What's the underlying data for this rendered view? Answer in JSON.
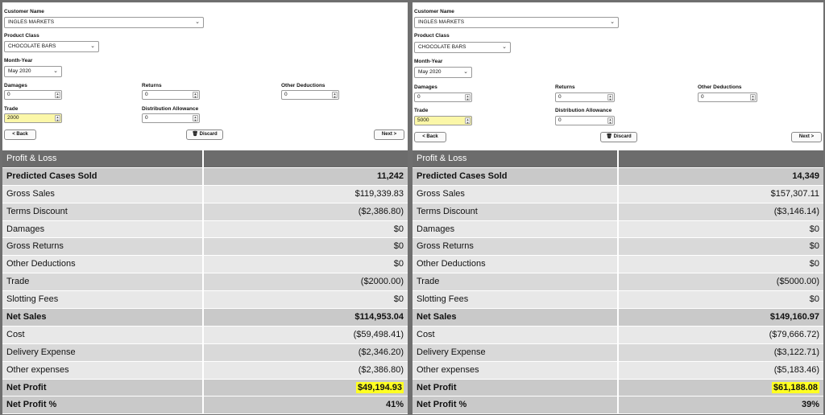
{
  "panels": [
    {
      "form": {
        "customer_label": "Customer Name",
        "customer_value": "INGLES MARKETS",
        "class_label": "Product Class",
        "class_value": "CHOCOLATE BARS",
        "month_label": "Month-Year",
        "month_value": "May 2020",
        "damages_label": "Damages",
        "damages_value": "0",
        "returns_label": "Returns",
        "returns_value": "0",
        "other_label": "Other Deductions",
        "other_value": "0",
        "trade_label": "Trade",
        "trade_value": "2000",
        "dist_label": "Distribution Allowance",
        "dist_value": "0",
        "back_label": "< Back",
        "discard_label": "Discard",
        "next_label": "Next >"
      },
      "pl": {
        "header": "Profit & Loss",
        "rows": [
          {
            "label": "Predicted Cases Sold",
            "value": "11,242"
          },
          {
            "label": "Gross Sales",
            "value": "$119,339.83"
          },
          {
            "label": "Terms Discount",
            "value": "($2,386.80)"
          },
          {
            "label": "Damages",
            "value": "$0"
          },
          {
            "label": "Gross Returns",
            "value": "$0"
          },
          {
            "label": "Other Deductions",
            "value": "$0"
          },
          {
            "label": "Trade",
            "value": "($2000.00)"
          },
          {
            "label": "Slotting Fees",
            "value": "$0"
          },
          {
            "label": "Net Sales",
            "value": "$114,953.04"
          },
          {
            "label": "Cost",
            "value": "($59,498.41)"
          },
          {
            "label": "Delivery Expense",
            "value": "($2,346.20)"
          },
          {
            "label": "Other expenses",
            "value": "($2,386.80)"
          },
          {
            "label": "Net Profit",
            "value": "$49,194.93"
          },
          {
            "label": "Net Profit %",
            "value": "41%"
          }
        ]
      }
    },
    {
      "form": {
        "customer_label": "Customer Name",
        "customer_value": "INGLES MARKETS",
        "class_label": "Product Class",
        "class_value": "CHOCOLATE BARS",
        "month_label": "Month-Year",
        "month_value": "May 2020",
        "damages_label": "Damages",
        "damages_value": "0",
        "returns_label": "Returns",
        "returns_value": "0",
        "other_label": "Other Deductions",
        "other_value": "0",
        "trade_label": "Trade",
        "trade_value": "5000",
        "dist_label": "Distribution Allowance",
        "dist_value": "0",
        "back_label": "< Back",
        "discard_label": "Discard",
        "next_label": "Next >"
      },
      "pl": {
        "header": "Profit & Loss",
        "rows": [
          {
            "label": "Predicted Cases Sold",
            "value": "14,349"
          },
          {
            "label": "Gross Sales",
            "value": "$157,307.11"
          },
          {
            "label": "Terms Discount",
            "value": "($3,146.14)"
          },
          {
            "label": "Damages",
            "value": "$0"
          },
          {
            "label": "Gross Returns",
            "value": "$0"
          },
          {
            "label": "Other Deductions",
            "value": "$0"
          },
          {
            "label": "Trade",
            "value": "($5000.00)"
          },
          {
            "label": "Slotting Fees",
            "value": "$0"
          },
          {
            "label": "Net Sales",
            "value": "$149,160.97"
          },
          {
            "label": "Cost",
            "value": "($79,666.72)"
          },
          {
            "label": "Delivery Expense",
            "value": "($3,122.71)"
          },
          {
            "label": "Other expenses",
            "value": "($5,183.46)"
          },
          {
            "label": "Net Profit",
            "value": "$61,188.08"
          },
          {
            "label": "Net Profit %",
            "value": "39%"
          }
        ]
      }
    }
  ]
}
